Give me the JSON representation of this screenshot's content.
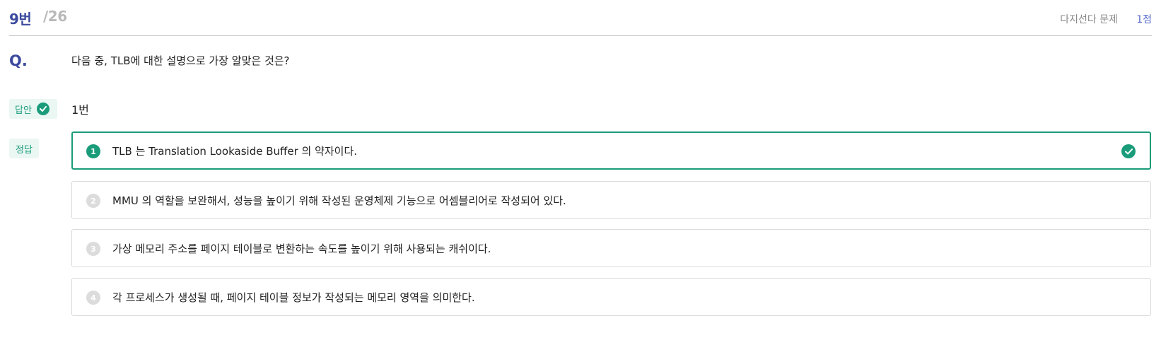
{
  "header": {
    "question_number": "9번",
    "question_total": "/26",
    "question_type": "다지선다 문제",
    "points": "1점"
  },
  "question": {
    "label": "Q.",
    "text": "다음 중, TLB에 대한 설명으로 가장 알맞은 것은?"
  },
  "answer": {
    "label": "답안",
    "value": "1번",
    "status_icon": "check-circle-icon"
  },
  "correct": {
    "label": "정답"
  },
  "options": [
    {
      "number": "1",
      "text": "TLB 는 Translation Lookaside Buffer 의 약자이다.",
      "is_correct": true
    },
    {
      "number": "2",
      "text": "MMU 의 역할을 보완해서, 성능을 높이기 위해 작성된 운영체제 기능으로 어셈블리어로 작성되어 있다.",
      "is_correct": false
    },
    {
      "number": "3",
      "text": "가상 메모리 주소를 페이지 테이블로 변환하는 속도를 높이기 위해 사용되는 캐쉬이다.",
      "is_correct": false
    },
    {
      "number": "4",
      "text": "각 프로세스가 생성될 때, 페이지 테이블 정보가 작성되는 메모리 영역을 의미한다.",
      "is_correct": false
    }
  ],
  "colors": {
    "accent_blue": "#3c4a9e",
    "correct_green": "#1a9c7a",
    "chip_bg": "#eaf7f3",
    "points_blue": "#5568c8"
  }
}
